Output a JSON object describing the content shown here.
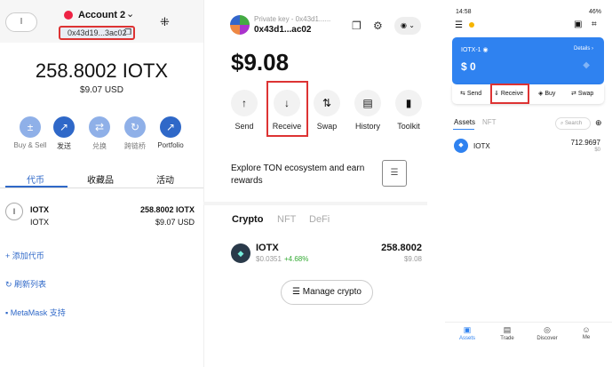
{
  "metamask": {
    "network_badge": "I",
    "account_name": "Account 2",
    "address": "0x43d19...3ac02",
    "balance": "258.8002 IOTX",
    "balance_usd": "$9.07 USD",
    "actions": [
      {
        "label": "Buy & Sell",
        "icon": "+−"
      },
      {
        "label": "发送",
        "icon": "↗"
      },
      {
        "label": "兑换",
        "icon": "⇄"
      },
      {
        "label": "跨链桥",
        "icon": "↻"
      },
      {
        "label": "Portfolio",
        "icon": "↗"
      }
    ],
    "tabs": [
      "代币",
      "收藏品",
      "活动"
    ],
    "token": {
      "symbol": "IOTX",
      "sub": "IOTX",
      "amount": "258.8002 IOTX",
      "usd": "$9.07 USD"
    },
    "links": [
      "+ 添加代币",
      "↻ 刷新列表",
      "MetaMask 支持"
    ]
  },
  "okx": {
    "pk_label": "Private key - 0x43d1......",
    "address": "0x43d1...ac02",
    "balance": "$9.08",
    "actions": [
      "Send",
      "Receive",
      "Swap",
      "History",
      "Toolkit"
    ],
    "promo": "Explore TON ecosystem and earn rewards",
    "tabs": [
      "Crypto",
      "NFT",
      "DeFi"
    ],
    "token": {
      "symbol": "IOTX",
      "price": "$0.0351",
      "change": "+4.68%",
      "amount": "258.8002",
      "usd": "$9.08"
    },
    "manage": "Manage crypto"
  },
  "tokenpocket": {
    "time": "14:58",
    "battery": "46%",
    "card_name": "IOTX-1",
    "details": "Details ›",
    "card_balance": "0",
    "actions": [
      "Send",
      "Receive",
      "Buy",
      "Swap"
    ],
    "tabs": [
      "Assets",
      "NFT"
    ],
    "search_placeholder": "Search",
    "token": {
      "symbol": "IOTX",
      "amount": "712.9697",
      "value": "$0"
    },
    "nav": [
      "Assets",
      "Trade",
      "Discover",
      "Me"
    ]
  }
}
